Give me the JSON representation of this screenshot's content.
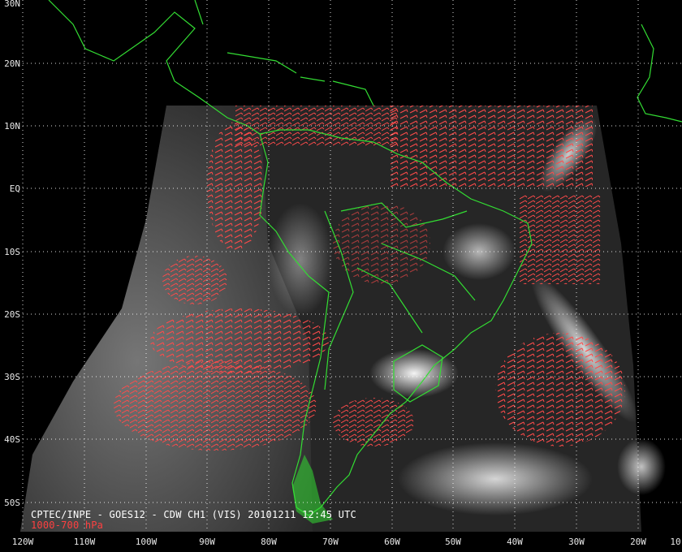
{
  "caption": {
    "title": "CPTEC/INPE - GOES12 - CDW CH1 (VIS) 20101211 12:45 UTC",
    "level": "1000-700 hPa"
  },
  "grid": {
    "lat_labels": [
      "30N",
      "20N",
      "10N",
      "EQ",
      "10S",
      "20S",
      "30S",
      "40S",
      "50S"
    ],
    "lon_labels": [
      "120W",
      "110W",
      "100W",
      "90W",
      "80W",
      "70W",
      "60W",
      "50W",
      "40W",
      "30W",
      "20W",
      "10"
    ]
  },
  "colors": {
    "background": "#000000",
    "coastline": "#33dd33",
    "wind_vectors": "#ff4a4a",
    "grid": "#ffffff",
    "caption_level": "#ff4040"
  },
  "legend": {
    "wind_vector_icon": "wind-barb-icon"
  }
}
